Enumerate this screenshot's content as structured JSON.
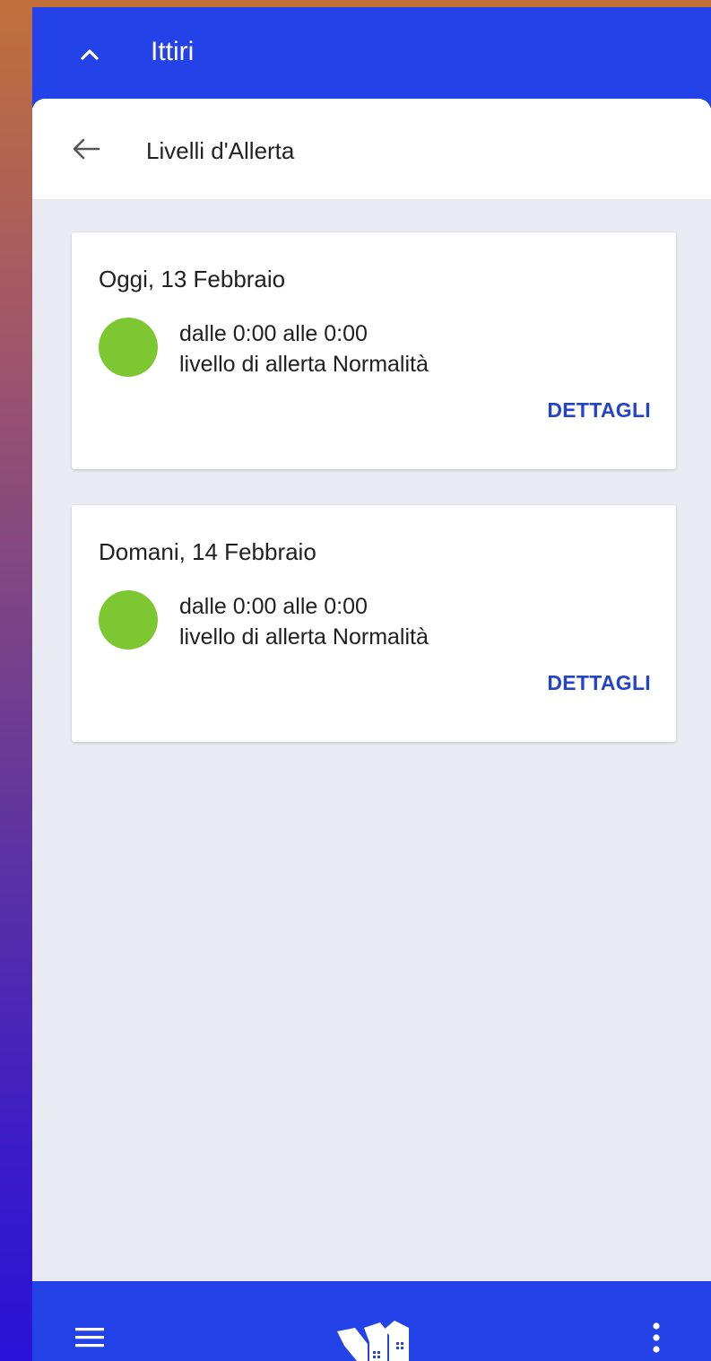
{
  "app": {
    "title": "Ittiri",
    "colors": {
      "primary": "#2342e8",
      "background": "#e9eaf2",
      "accent": "#2344c8",
      "status_normal": "#7dc832"
    },
    "icons": {
      "collapse": "chevron-up-icon",
      "back": "arrow-left-icon",
      "menu": "hamburger-menu-icon",
      "logo": "app-logo-icon",
      "more": "more-vert-icon"
    }
  },
  "page": {
    "heading": "Livelli d'Allerta"
  },
  "alerts": [
    {
      "date": "Oggi, 13 Febbraio",
      "time_range": "dalle 0:00 alle 0:00",
      "level_text": "livello di allerta Normalità",
      "status_color": "#7dc832",
      "details_label": "DETTAGLI"
    },
    {
      "date": "Domani, 14 Febbraio",
      "time_range": "dalle 0:00 alle 0:00",
      "level_text": "livello di allerta Normalità",
      "status_color": "#7dc832",
      "details_label": "DETTAGLI"
    }
  ]
}
